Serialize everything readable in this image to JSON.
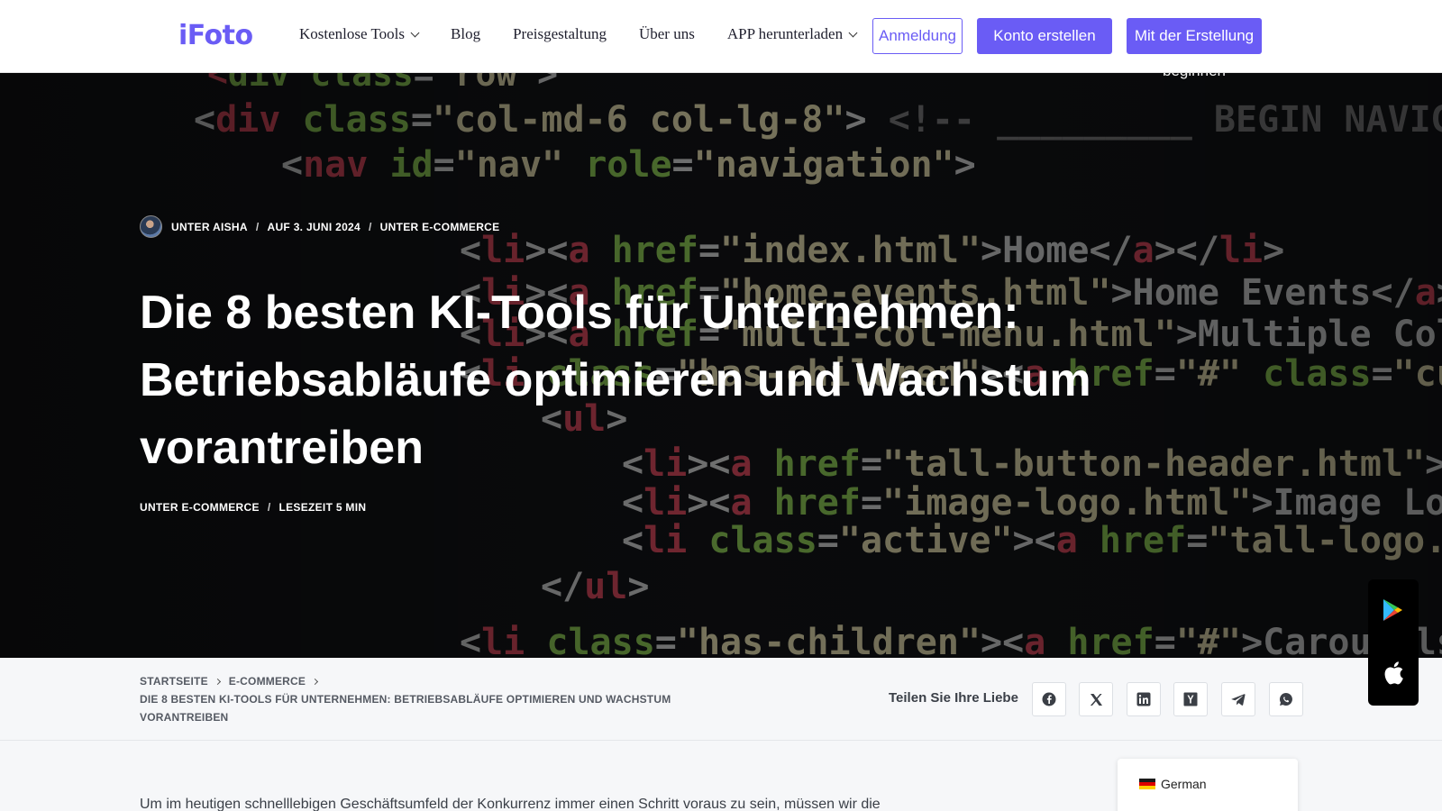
{
  "header": {
    "logo": "iFoto",
    "nav": [
      {
        "label": "Kostenlose Tools",
        "dropdown": true
      },
      {
        "label": "Blog",
        "dropdown": false
      },
      {
        "label": "Preisgestaltung",
        "dropdown": false
      },
      {
        "label": "Über uns",
        "dropdown": false
      },
      {
        "label": "APP herunterladen",
        "dropdown": true
      }
    ],
    "login_label": "Anmeldung",
    "create_label": "Konto erstellen",
    "start_label": "Mit der Erstellung",
    "start_label_overflow": "beginnen"
  },
  "hero": {
    "author": "UNTER AISHA",
    "date": "AUF 3. JUNI 2024",
    "category": "UNTER E-COMMERCE",
    "title": "Die 8 besten KI-Tools für Unternehmen: Betriebsabläufe optimieren und Wachstum vorantreiben",
    "category2": "UNTER E-COMMERCE",
    "read_time": "LESEZEIT 5 MIN"
  },
  "breadcrumb": {
    "home": "STARTSEITE",
    "section": "E-COMMERCE",
    "current": "DIE 8 BESTEN KI-TOOLS FÜR UNTERNEHMEN: BETRIEBSABLÄUFE OPTIMIEREN UND WACHSTUM VORANTREIBEN"
  },
  "share": {
    "label": "Teilen Sie Ihre Liebe",
    "icons": [
      "facebook-icon",
      "x-icon",
      "linkedin-icon",
      "hackernews-icon",
      "telegram-icon",
      "whatsapp-icon"
    ]
  },
  "content": {
    "intro": "Um im heutigen schnelllebigen Geschäftsumfeld der Konkurrenz immer einen Schritt voraus zu sein, müssen wir die"
  },
  "language": {
    "label": "German"
  },
  "app_badges": [
    "google-play-icon",
    "apple-icon"
  ],
  "colors": {
    "accent": "#6a5cf5",
    "logo_blue": "#4f8dfc"
  }
}
